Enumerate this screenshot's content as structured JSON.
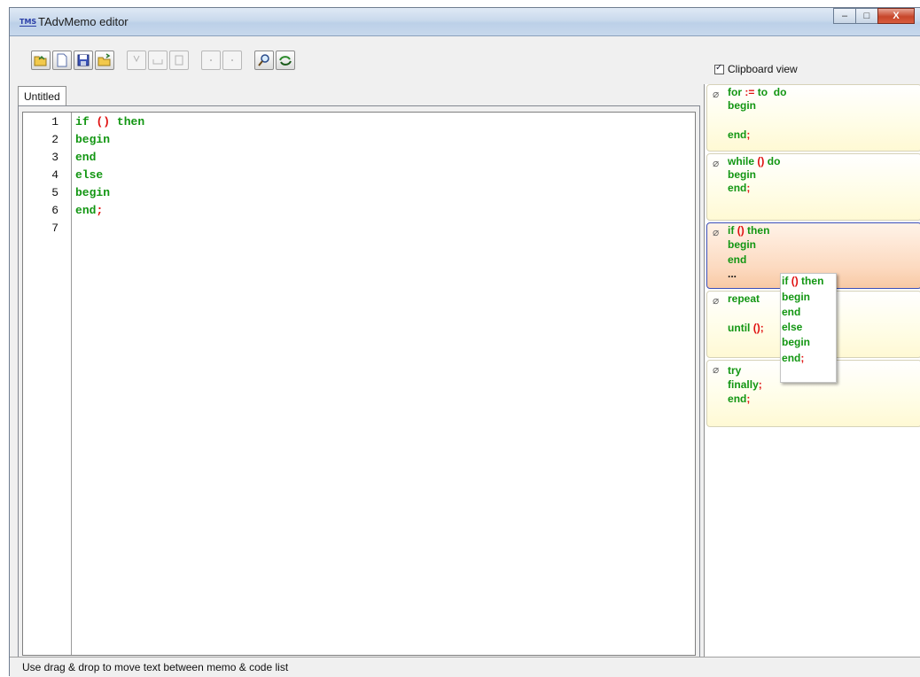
{
  "window": {
    "title": "TAdvMemo editor",
    "app_icon_text": "TMS",
    "controls": {
      "minimize": "–",
      "maximize": "□",
      "close": "X"
    }
  },
  "toolbar": {
    "buttons": [
      {
        "name": "open-button",
        "icon": "open-folder-icon",
        "enabled": true
      },
      {
        "name": "new-button",
        "icon": "new-document-icon",
        "enabled": true
      },
      {
        "name": "save-button",
        "icon": "floppy-disk-icon",
        "enabled": true
      },
      {
        "name": "save-as-button",
        "icon": "export-folder-icon",
        "enabled": true
      },
      {
        "name": "cut-button",
        "icon": "cut-icon",
        "enabled": false
      },
      {
        "name": "copy-button",
        "icon": "copy-icon",
        "enabled": false
      },
      {
        "name": "paste-button",
        "icon": "paste-icon",
        "enabled": false
      },
      {
        "name": "undo-button",
        "icon": "undo-icon",
        "enabled": false
      },
      {
        "name": "redo-button",
        "icon": "redo-icon",
        "enabled": false
      },
      {
        "name": "find-button",
        "icon": "magnifier-icon",
        "enabled": true
      },
      {
        "name": "replace-button",
        "icon": "find-replace-icon",
        "enabled": true
      }
    ],
    "clipboard_view_label": "Clipboard view",
    "clipboard_view_checked": true
  },
  "tabs": [
    {
      "label": "Untitled",
      "active": true
    }
  ],
  "editor": {
    "lines": [
      {
        "num": "1",
        "text": "if () then"
      },
      {
        "num": "2",
        "text": "begin"
      },
      {
        "num": "3",
        "text": "end"
      },
      {
        "num": "4",
        "text": "else"
      },
      {
        "num": "5",
        "text": "begin"
      },
      {
        "num": "6",
        "text": "end;"
      },
      {
        "num": "7",
        "text": ""
      }
    ]
  },
  "code_list": {
    "snippets": [
      {
        "lines": [
          "for := to  do",
          "begin",
          "",
          "end;"
        ]
      },
      {
        "lines": [
          "while () do",
          "begin",
          "end;"
        ]
      },
      {
        "lines": [
          "if () then",
          "begin",
          "end",
          "..."
        ],
        "selected": true
      },
      {
        "lines": [
          "repeat",
          "",
          "until ();"
        ]
      },
      {
        "lines": [
          "try",
          "finally;",
          "end;"
        ]
      }
    ]
  },
  "drag_preview": {
    "lines": [
      "if () then",
      "begin",
      "end",
      "else",
      "begin",
      "end;"
    ]
  },
  "statusbar": {
    "text": "Use drag & drop to move text between memo & code list"
  },
  "colors": {
    "keyword_green": "#129612",
    "symbol_red": "#e01010",
    "selection_border": "#3b4fb8"
  }
}
